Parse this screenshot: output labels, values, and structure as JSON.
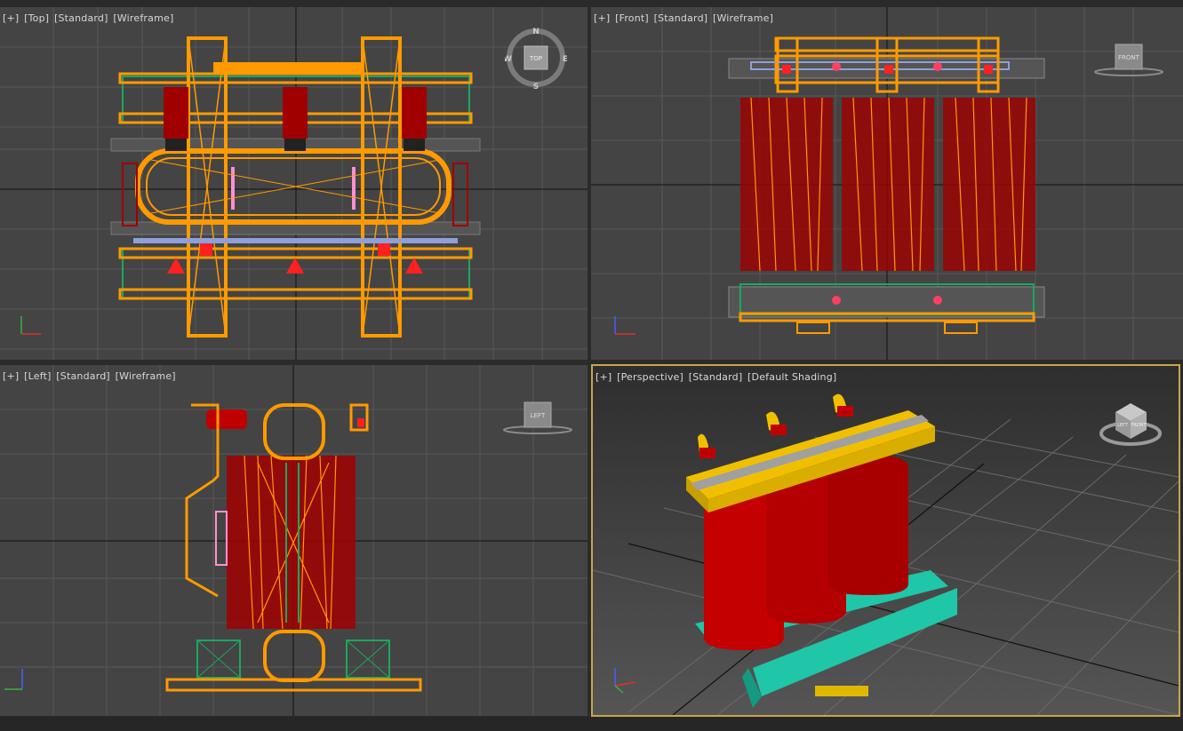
{
  "viewports": {
    "top": {
      "menu": "[+]",
      "view": "[Top]",
      "mode": "[Standard]",
      "shading": "[Wireframe]",
      "cube_label": "TOP",
      "compass": {
        "n": "N",
        "s": "S",
        "e": "E",
        "w": "W"
      },
      "axis": {
        "x": "x",
        "y": "y"
      }
    },
    "front": {
      "menu": "[+]",
      "view": "[Front]",
      "mode": "[Standard]",
      "shading": "[Wireframe]",
      "cube_label": "FRONT",
      "axis": {
        "x": "x",
        "y": "z"
      }
    },
    "left": {
      "menu": "[+]",
      "view": "[Left]",
      "mode": "[Standard]",
      "shading": "[Wireframe]",
      "cube_label": "LEFT",
      "axis": {
        "x": "y",
        "y": "z"
      }
    },
    "perspective": {
      "menu": "[+]",
      "view": "[Perspective]",
      "mode": "[Standard]",
      "shading": "[Default Shading]",
      "cube_faces": {
        "left": "LEFT",
        "front": "FRONT"
      },
      "axis": {
        "x": "x",
        "y": "z"
      }
    }
  },
  "colors": {
    "viewport_bg": "#444444",
    "grid_line": "#575757",
    "axis_line": "#111111",
    "active_border": "#c9a54a",
    "wire_orange": "#ff9a00",
    "wire_red": "#a00000",
    "wire_green": "#1aa860",
    "shaded_red": "#c50000",
    "shaded_yellow": "#f0c000",
    "shaded_teal": "#1fc6a8",
    "shaded_gray": "#9a9a9a"
  }
}
